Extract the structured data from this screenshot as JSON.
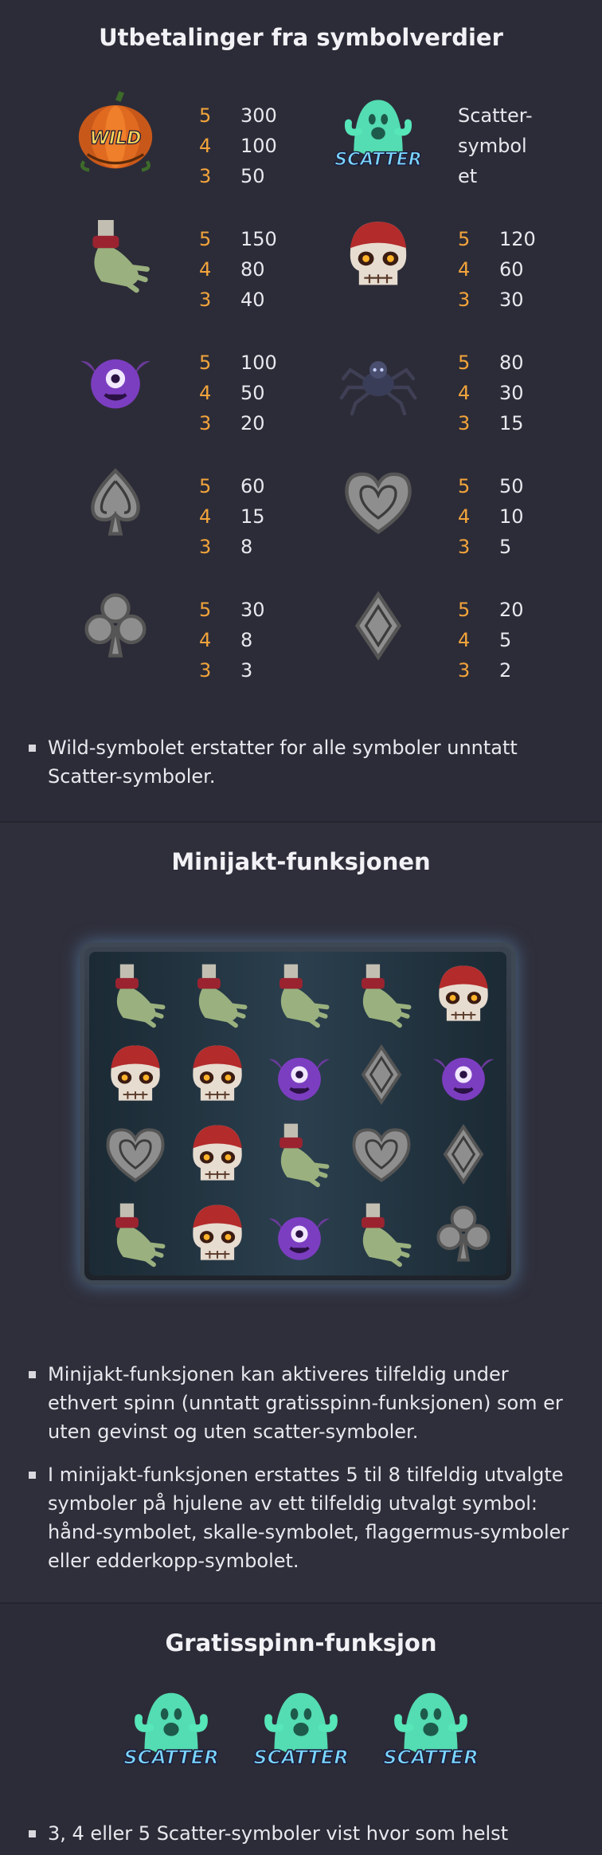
{
  "section1": {
    "title": "Utbetalinger fra symbolverdier",
    "paytable": [
      {
        "left_icon": "wild-pumpkin-icon",
        "left": [
          {
            "k": "5",
            "v": "300"
          },
          {
            "k": "4",
            "v": "100"
          },
          {
            "k": "3",
            "v": "50"
          }
        ],
        "right_icon": "scatter-ghost-icon",
        "right_text": [
          "Scatter-",
          "symbol",
          "et"
        ]
      },
      {
        "left_icon": "zombie-hand-icon",
        "left": [
          {
            "k": "5",
            "v": "150"
          },
          {
            "k": "4",
            "v": "80"
          },
          {
            "k": "3",
            "v": "40"
          }
        ],
        "right_icon": "skull-icon",
        "right": [
          {
            "k": "5",
            "v": "120"
          },
          {
            "k": "4",
            "v": "60"
          },
          {
            "k": "3",
            "v": "30"
          }
        ]
      },
      {
        "left_icon": "bat-icon",
        "left": [
          {
            "k": "5",
            "v": "100"
          },
          {
            "k": "4",
            "v": "50"
          },
          {
            "k": "3",
            "v": "20"
          }
        ],
        "right_icon": "spider-icon",
        "right": [
          {
            "k": "5",
            "v": "80"
          },
          {
            "k": "4",
            "v": "30"
          },
          {
            "k": "3",
            "v": "15"
          }
        ]
      },
      {
        "left_icon": "spade-icon",
        "left": [
          {
            "k": "5",
            "v": "60"
          },
          {
            "k": "4",
            "v": "15"
          },
          {
            "k": "3",
            "v": "8"
          }
        ],
        "right_icon": "heart-icon",
        "right": [
          {
            "k": "5",
            "v": "50"
          },
          {
            "k": "4",
            "v": "10"
          },
          {
            "k": "3",
            "v": "5"
          }
        ]
      },
      {
        "left_icon": "club-icon",
        "left": [
          {
            "k": "5",
            "v": "30"
          },
          {
            "k": "4",
            "v": "8"
          },
          {
            "k": "3",
            "v": "3"
          }
        ],
        "right_icon": "diamond-icon",
        "right": [
          {
            "k": "5",
            "v": "20"
          },
          {
            "k": "4",
            "v": "5"
          },
          {
            "k": "3",
            "v": "2"
          }
        ]
      }
    ],
    "wild_label": "WILD",
    "scatter_label": "SCATTER",
    "bullet": "Wild-symbolet erstatter for alle symboler unntatt Scatter-symboler."
  },
  "section2": {
    "title": "Minijakt-funksjonen",
    "grid": [
      [
        "hand",
        "hand",
        "hand",
        "hand",
        "skull"
      ],
      [
        "skull",
        "skull",
        "bat",
        "diamond",
        "bat"
      ],
      [
        "heart",
        "skull",
        "hand",
        "heart",
        "diamond"
      ],
      [
        "hand",
        "skull",
        "bat",
        "hand",
        "club"
      ]
    ],
    "bullets": [
      "Minijakt-funksjonen kan aktiveres tilfeldig under ethvert spinn (unntatt gratisspinn-funksjonen) som er uten gevinst og uten scatter-symboler.",
      "I minijakt-funksjonen erstattes 5 til 8 tilfeldig utvalgte symboler på hjulene av ett tilfeldig utvalgt symbol: hånd-symbolet, skalle-symbolet, flaggermus-symboler eller edderkopp-symbolet."
    ]
  },
  "section3": {
    "title": "Gratisspinn-funksjon",
    "scatter_count": 3,
    "scatter_label": "SCATTER",
    "bullet": "3, 4 eller 5 Scatter-symboler vist hvor som helst"
  },
  "colors": {
    "background": "#2c2c38",
    "multiplier": "#f3a43b",
    "text": "#e8e8ee",
    "ghost": "#3fe0b0"
  }
}
